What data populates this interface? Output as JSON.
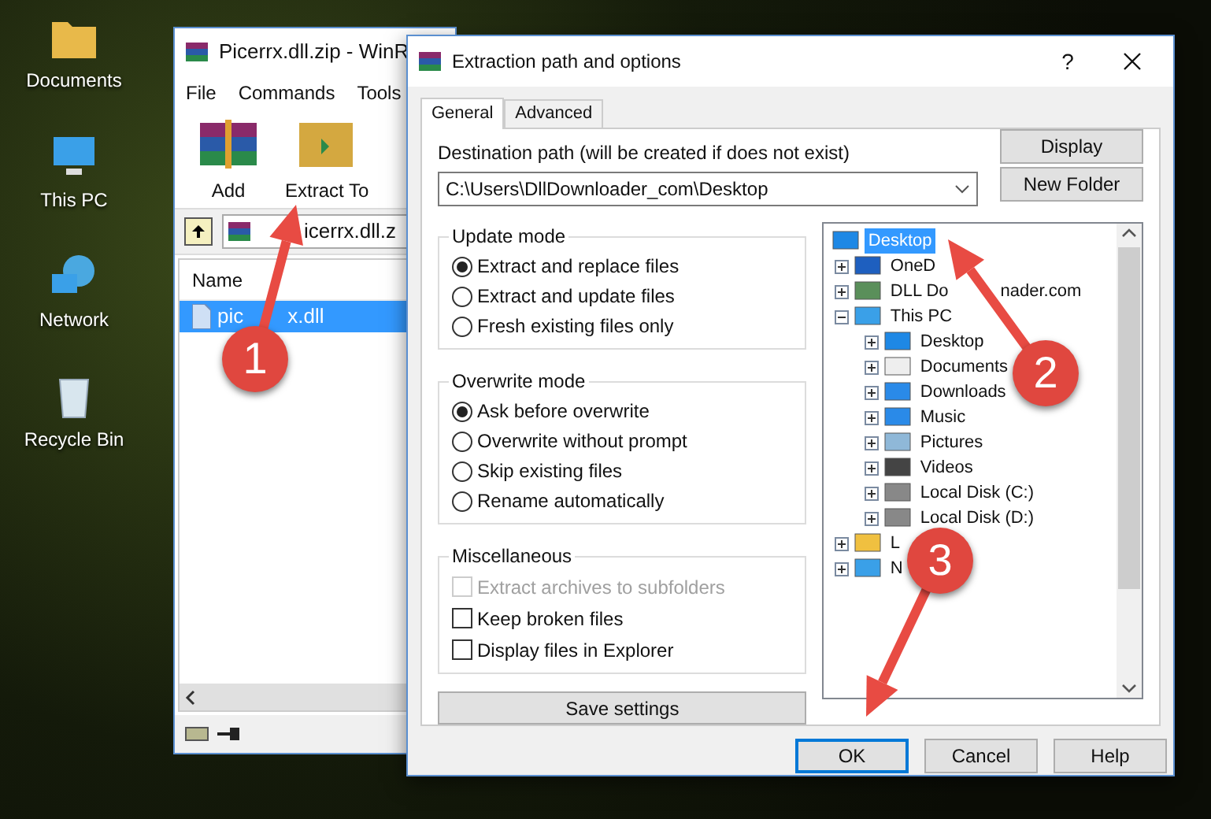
{
  "desktop": {
    "icons": [
      {
        "label": "Documents"
      },
      {
        "label": "This PC"
      },
      {
        "label": "Network"
      },
      {
        "label": "Recycle Bin"
      }
    ]
  },
  "archiver": {
    "title": "Picerrx.dll.zip - WinR",
    "menu": [
      "File",
      "Commands",
      "Tools"
    ],
    "toolbar": [
      {
        "label": "Add"
      },
      {
        "label": "Extract To"
      }
    ],
    "address": "icerrx.dll.z",
    "columns": [
      "Name"
    ],
    "files": [
      {
        "label": "pic",
        "label_tail": "x.dll",
        "selected": true
      }
    ]
  },
  "dialog": {
    "title": "Extraction path and options",
    "help": "?",
    "tabs": [
      {
        "label": "General",
        "selected": true
      },
      {
        "label": "Advanced",
        "selected": false
      }
    ],
    "destination": {
      "label": "Destination path (will be created if does not exist)",
      "value": "C:\\Users\\DllDownloader_com\\Desktop"
    },
    "side_buttons": [
      "Display",
      "New Folder"
    ],
    "groups": [
      {
        "title": "Update mode",
        "kind": "radio",
        "options": [
          {
            "label": "Extract and replace files",
            "selected": true
          },
          {
            "label": "Extract and update files",
            "selected": false
          },
          {
            "label": "Fresh existing files only",
            "selected": false
          }
        ]
      },
      {
        "title": "Overwrite mode",
        "kind": "radio",
        "options": [
          {
            "label": "Ask before overwrite",
            "selected": true
          },
          {
            "label": "Overwrite without prompt",
            "selected": false
          },
          {
            "label": "Skip existing files",
            "selected": false
          },
          {
            "label": "Rename automatically",
            "selected": false
          }
        ]
      },
      {
        "title": "Miscellaneous",
        "kind": "checkbox",
        "options": [
          {
            "label": "Extract archives to subfolders",
            "checked": false,
            "disabled": true
          },
          {
            "label": "Keep broken files",
            "checked": false,
            "disabled": false
          },
          {
            "label": "Display files in Explorer",
            "checked": false,
            "disabled": false
          }
        ]
      }
    ],
    "save_button": "Save settings",
    "tree": [
      {
        "label": "Desktop",
        "selected": true,
        "children": [
          {
            "label": "OneD",
            "selected": false,
            "expanded": false
          },
          {
            "label": "DLL Do",
            "label_tail": "nader.com",
            "selected": false,
            "expanded": false
          },
          {
            "label": "This PC",
            "selected": false,
            "expanded": true,
            "children": [
              {
                "label": "Desktop",
                "selected": false,
                "expanded": false
              },
              {
                "label": "Documents",
                "selected": false,
                "expanded": false
              },
              {
                "label": "Downloads",
                "selected": false,
                "expanded": false
              },
              {
                "label": "Music",
                "selected": false,
                "expanded": false
              },
              {
                "label": "Pictures",
                "selected": false,
                "expanded": false
              },
              {
                "label": "Videos",
                "selected": false,
                "expanded": false
              },
              {
                "label": "Local Disk (C:)",
                "selected": false,
                "expanded": false
              },
              {
                "label": "Local Disk (D:)",
                "selected": false,
                "expanded": false
              }
            ]
          },
          {
            "label": "L",
            "selected": false,
            "expanded": false
          },
          {
            "label": "N",
            "selected": false,
            "expanded": false
          }
        ]
      }
    ],
    "buttons": [
      {
        "label": "OK",
        "default": true
      },
      {
        "label": "Cancel",
        "default": false
      },
      {
        "label": "Help",
        "default": false
      }
    ]
  },
  "callouts": [
    {
      "label": "1"
    },
    {
      "label": "2"
    },
    {
      "label": "3"
    }
  ]
}
